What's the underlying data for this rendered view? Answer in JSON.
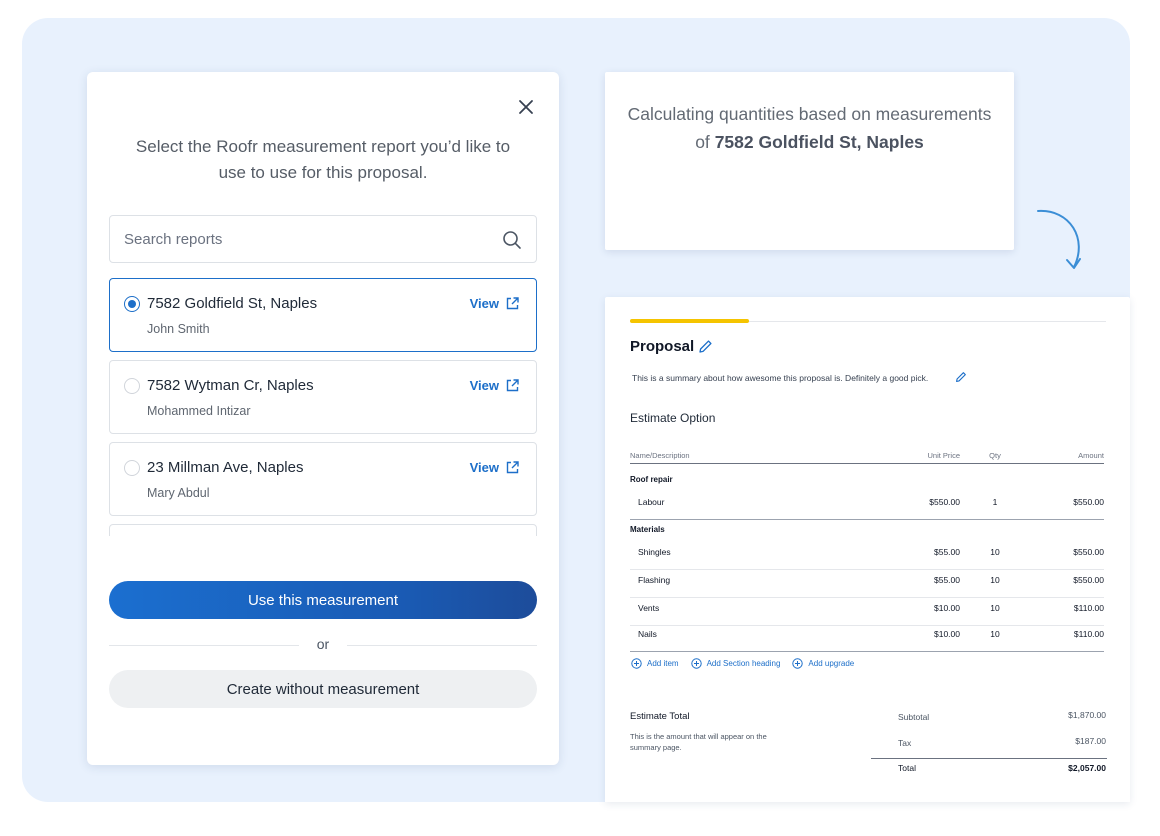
{
  "modal": {
    "title": "Select the Roofr measurement report you’d like to use to use for this proposal.",
    "search_placeholder": "Search reports",
    "reports": [
      {
        "address": "7582 Goldfield St, Naples",
        "person": "John Smith",
        "view_label": "View",
        "selected": true
      },
      {
        "address": "7582 Wytman Cr, Naples",
        "person": "Mohammed Intizar",
        "view_label": "View",
        "selected": false
      },
      {
        "address": "23 Millman Ave, Naples",
        "person": "Mary Abdul",
        "view_label": "View",
        "selected": false
      }
    ],
    "primary_button": "Use this measurement",
    "or_label": "or",
    "secondary_button": "Create without measurement"
  },
  "calculating": {
    "line1": "Calculating quantities based on measurements",
    "prefix": "of",
    "address": "7582 Goldfield St, Naples"
  },
  "proposal": {
    "progress": 0.25,
    "title": "Proposal",
    "summary": "This is a summary about how awesome this proposal is. Definitely a good pick.",
    "estimate_option": "Estimate Option",
    "columns": {
      "name": "Name/Description",
      "price": "Unit Price",
      "qty": "Qty",
      "amount": "Amount"
    },
    "sections": [
      {
        "heading": "Roof repair",
        "rows": [
          {
            "name": "Labour",
            "price": "$550.00",
            "qty": "1",
            "amount": "$550.00"
          }
        ]
      },
      {
        "heading": "Materials",
        "rows": [
          {
            "name": "Shingles",
            "price": "$55.00",
            "qty": "10",
            "amount": "$550.00"
          },
          {
            "name": "Flashing",
            "price": "$55.00",
            "qty": "10",
            "amount": "$550.00"
          },
          {
            "name": "Vents",
            "price": "$10.00",
            "qty": "10",
            "amount": "$110.00"
          },
          {
            "name": "Nails",
            "price": "$10.00",
            "qty": "10",
            "amount": "$110.00"
          }
        ]
      }
    ],
    "add_links": {
      "item": "Add item",
      "section": "Add Section heading",
      "upgrade": "Add upgrade"
    },
    "estimate_total": {
      "title": "Estimate Total",
      "note": "This is the amount that will appear on the summary page.",
      "subtotal_label": "Subtotal",
      "subtotal": "$1,870.00",
      "tax_label": "Tax",
      "tax": "$187.00",
      "total_label": "Total",
      "total": "$2,057.00"
    }
  },
  "colors": {
    "backdrop": "#e8f1fd",
    "accent": "#1d6fc9",
    "progress": "#f5c400"
  }
}
